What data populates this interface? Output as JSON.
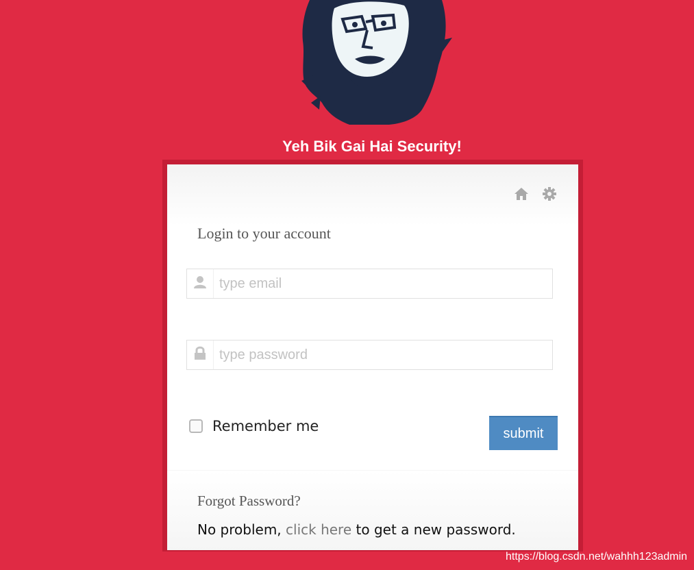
{
  "header": {
    "title": "Yeh Bik Gai Hai Security!",
    "logo_icon": "portrait-logo",
    "background_color": "#e02a44"
  },
  "toolbar": {
    "home_icon": "home-icon",
    "settings_icon": "gear-icon"
  },
  "login": {
    "heading": "Login to your account",
    "email": {
      "placeholder": "type email",
      "value": "",
      "icon": "user-icon"
    },
    "password": {
      "placeholder": "type password",
      "value": "",
      "icon": "lock-icon"
    },
    "remember_label": "Remember me",
    "remember_checked": false,
    "submit_label": "submit",
    "submit_color": "#4f8bc3"
  },
  "forgot": {
    "title": "Forgot Password?",
    "text_before": "No problem, ",
    "link_text": "click here",
    "text_after": " to get a new password."
  },
  "watermark": "https://blog.csdn.net/wahhh123admin"
}
